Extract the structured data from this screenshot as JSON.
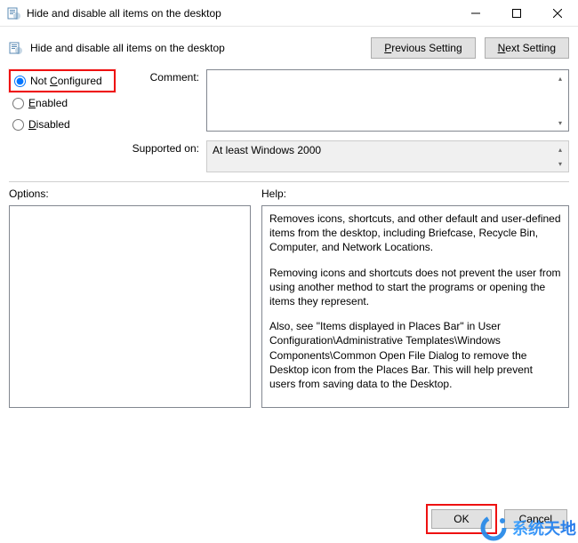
{
  "window": {
    "title": "Hide and disable all items on the desktop"
  },
  "header": {
    "title": "Hide and disable all items on the desktop",
    "prev_label": "Previous Setting",
    "next_label": "Next Setting"
  },
  "radios": {
    "not_configured": "Not Configured",
    "enabled": "Enabled",
    "disabled": "Disabled",
    "selected": "not_configured"
  },
  "labels": {
    "comment": "Comment:",
    "supported_on": "Supported on:",
    "options": "Options:",
    "help": "Help:"
  },
  "comment_value": "",
  "supported_on_value": "At least Windows 2000",
  "help": {
    "p1": "Removes icons, shortcuts, and other default and user-defined items from the desktop, including Briefcase, Recycle Bin, Computer, and Network Locations.",
    "p2": "Removing icons and shortcuts does not prevent the user from using another method to start the programs or opening the items they represent.",
    "p3": "Also, see \"Items displayed in Places Bar\" in User Configuration\\Administrative Templates\\Windows Components\\Common Open File Dialog to remove the Desktop icon from the Places Bar. This will help prevent users from saving data to the Desktop."
  },
  "footer": {
    "ok": "OK",
    "cancel": "Cancel"
  },
  "watermark": "系统天地"
}
